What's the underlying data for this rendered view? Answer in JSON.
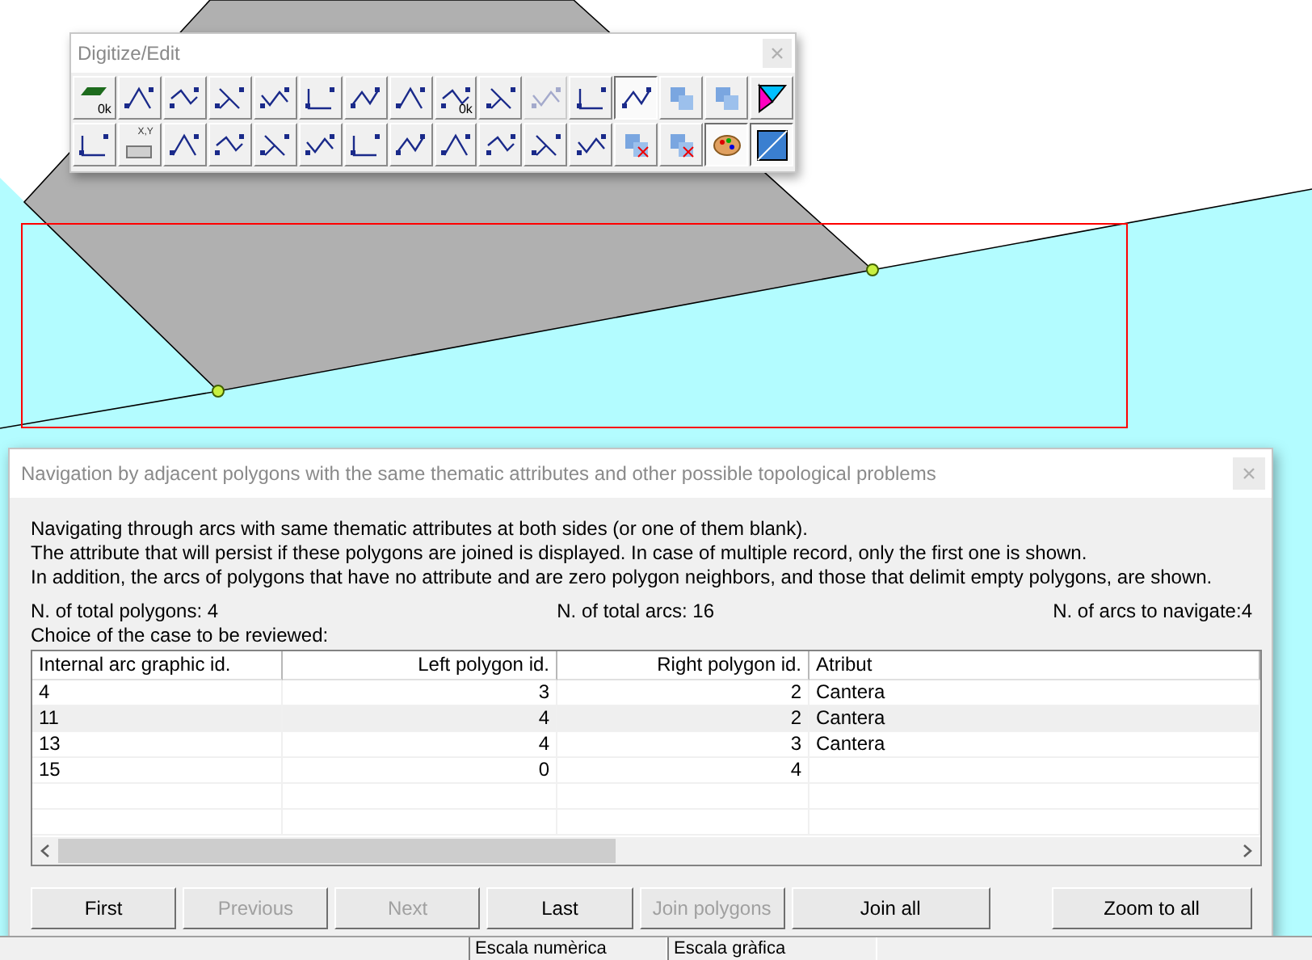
{
  "toolbar": {
    "title": "Digitize/Edit",
    "rows": [
      [
        {
          "pressed": false,
          "disabled": false,
          "text": "0k"
        },
        {
          "pressed": false,
          "disabled": false
        },
        {
          "pressed": false,
          "disabled": false
        },
        {
          "pressed": false,
          "disabled": false
        },
        {
          "pressed": false,
          "disabled": false
        },
        {
          "pressed": false,
          "disabled": false
        },
        {
          "pressed": false,
          "disabled": false
        },
        {
          "pressed": false,
          "disabled": false
        },
        {
          "pressed": false,
          "disabled": false,
          "text": "0k"
        },
        {
          "pressed": false,
          "disabled": false
        },
        {
          "pressed": false,
          "disabled": true
        },
        {
          "pressed": false,
          "disabled": false
        },
        {
          "pressed": true,
          "disabled": false
        },
        {
          "pressed": false,
          "disabled": false
        },
        {
          "pressed": false,
          "disabled": false
        },
        {
          "pressed": false,
          "disabled": false
        }
      ],
      [
        {
          "pressed": false,
          "disabled": false
        },
        {
          "pressed": false,
          "disabled": false,
          "text": "X,Y"
        },
        {
          "pressed": false,
          "disabled": false
        },
        {
          "pressed": false,
          "disabled": false
        },
        {
          "pressed": false,
          "disabled": false
        },
        {
          "pressed": false,
          "disabled": false
        },
        {
          "pressed": false,
          "disabled": false
        },
        {
          "pressed": false,
          "disabled": false
        },
        {
          "pressed": false,
          "disabled": false
        },
        {
          "pressed": false,
          "disabled": false
        },
        {
          "pressed": false,
          "disabled": false
        },
        {
          "pressed": false,
          "disabled": false
        },
        {
          "pressed": false,
          "disabled": false
        },
        {
          "pressed": false,
          "disabled": false
        },
        {
          "pressed": true,
          "disabled": false
        },
        {
          "pressed": true,
          "disabled": false
        }
      ]
    ]
  },
  "dialog": {
    "title": "Navigation by adjacent polygons with the same thematic attributes and other possible topological problems",
    "description": [
      "Navigating through arcs with same thematic attributes at both sides (or one of them blank).",
      "The attribute that will persist if these polygons are joined is displayed. In case of multiple record, only the first one is shown.",
      "In addition, the arcs of polygons that have no attribute and are zero polygon neighbors, and those that delimit empty polygons, are shown."
    ],
    "stats": [
      "N. of total polygons: 4",
      "N. of total arcs: 16",
      "N. of arcs to navigate:4"
    ],
    "choice_label": "Choice of the case to be reviewed:",
    "table": {
      "columns": [
        {
          "label": "Internal arc graphic id."
        },
        {
          "label": "Left polygon id."
        },
        {
          "label": "Right polygon id."
        },
        {
          "label": "Atribut"
        }
      ],
      "rows": [
        {
          "cells": [
            "4",
            "3",
            "2",
            "Cantera"
          ],
          "selected": false
        },
        {
          "cells": [
            "11",
            "4",
            "2",
            "Cantera"
          ],
          "selected": true
        },
        {
          "cells": [
            "13",
            "4",
            "3",
            "Cantera"
          ],
          "selected": false
        },
        {
          "cells": [
            "15",
            "0",
            "4",
            ""
          ],
          "selected": false
        }
      ]
    },
    "buttons": [
      {
        "label": "First",
        "disabled": false
      },
      {
        "label": "Previous",
        "disabled": true
      },
      {
        "label": "Next",
        "disabled": true
      },
      {
        "label": "Last",
        "disabled": false
      },
      {
        "label": "Join polygons",
        "disabled": true
      },
      {
        "label": "Join all",
        "disabled": false
      },
      {
        "label": "Zoom to all",
        "disabled": false
      }
    ]
  },
  "status_bar": [
    "Escala numèrica",
    "Escala gràfica"
  ]
}
